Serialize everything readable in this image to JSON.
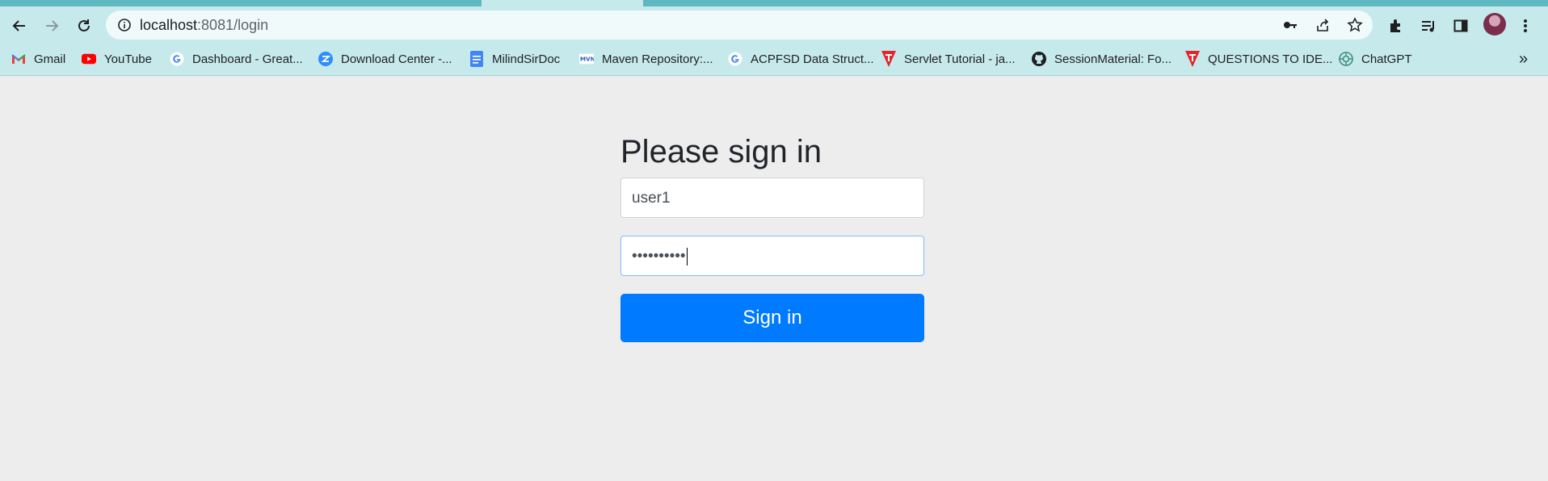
{
  "browser": {
    "url_host": "localhost",
    "url_rest": ":8081/login",
    "bookmarks": [
      {
        "label": "Gmail",
        "icon": "gmail-icon"
      },
      {
        "label": "YouTube",
        "icon": "youtube-icon"
      },
      {
        "label": "Dashboard - Great...",
        "icon": "google-icon"
      },
      {
        "label": "Download Center -...",
        "icon": "zoom-icon"
      },
      {
        "label": "MilindSirDoc",
        "icon": "docs-icon"
      },
      {
        "label": "Maven Repository:...",
        "icon": "maven-icon"
      },
      {
        "label": "ACPFSD Data Struct...",
        "icon": "google-icon"
      },
      {
        "label": "Servlet Tutorial - ja...",
        "icon": "tutorial-icon"
      },
      {
        "label": "SessionMaterial: Fo...",
        "icon": "github-icon"
      },
      {
        "label": "QUESTIONS TO IDE...",
        "icon": "tutorial-icon"
      },
      {
        "label": "ChatGPT",
        "icon": "chatgpt-icon"
      }
    ],
    "more_label": "»"
  },
  "login": {
    "heading": "Please sign in",
    "username_value": "user1",
    "password_masked": "••••••••••",
    "submit_label": "Sign in"
  }
}
